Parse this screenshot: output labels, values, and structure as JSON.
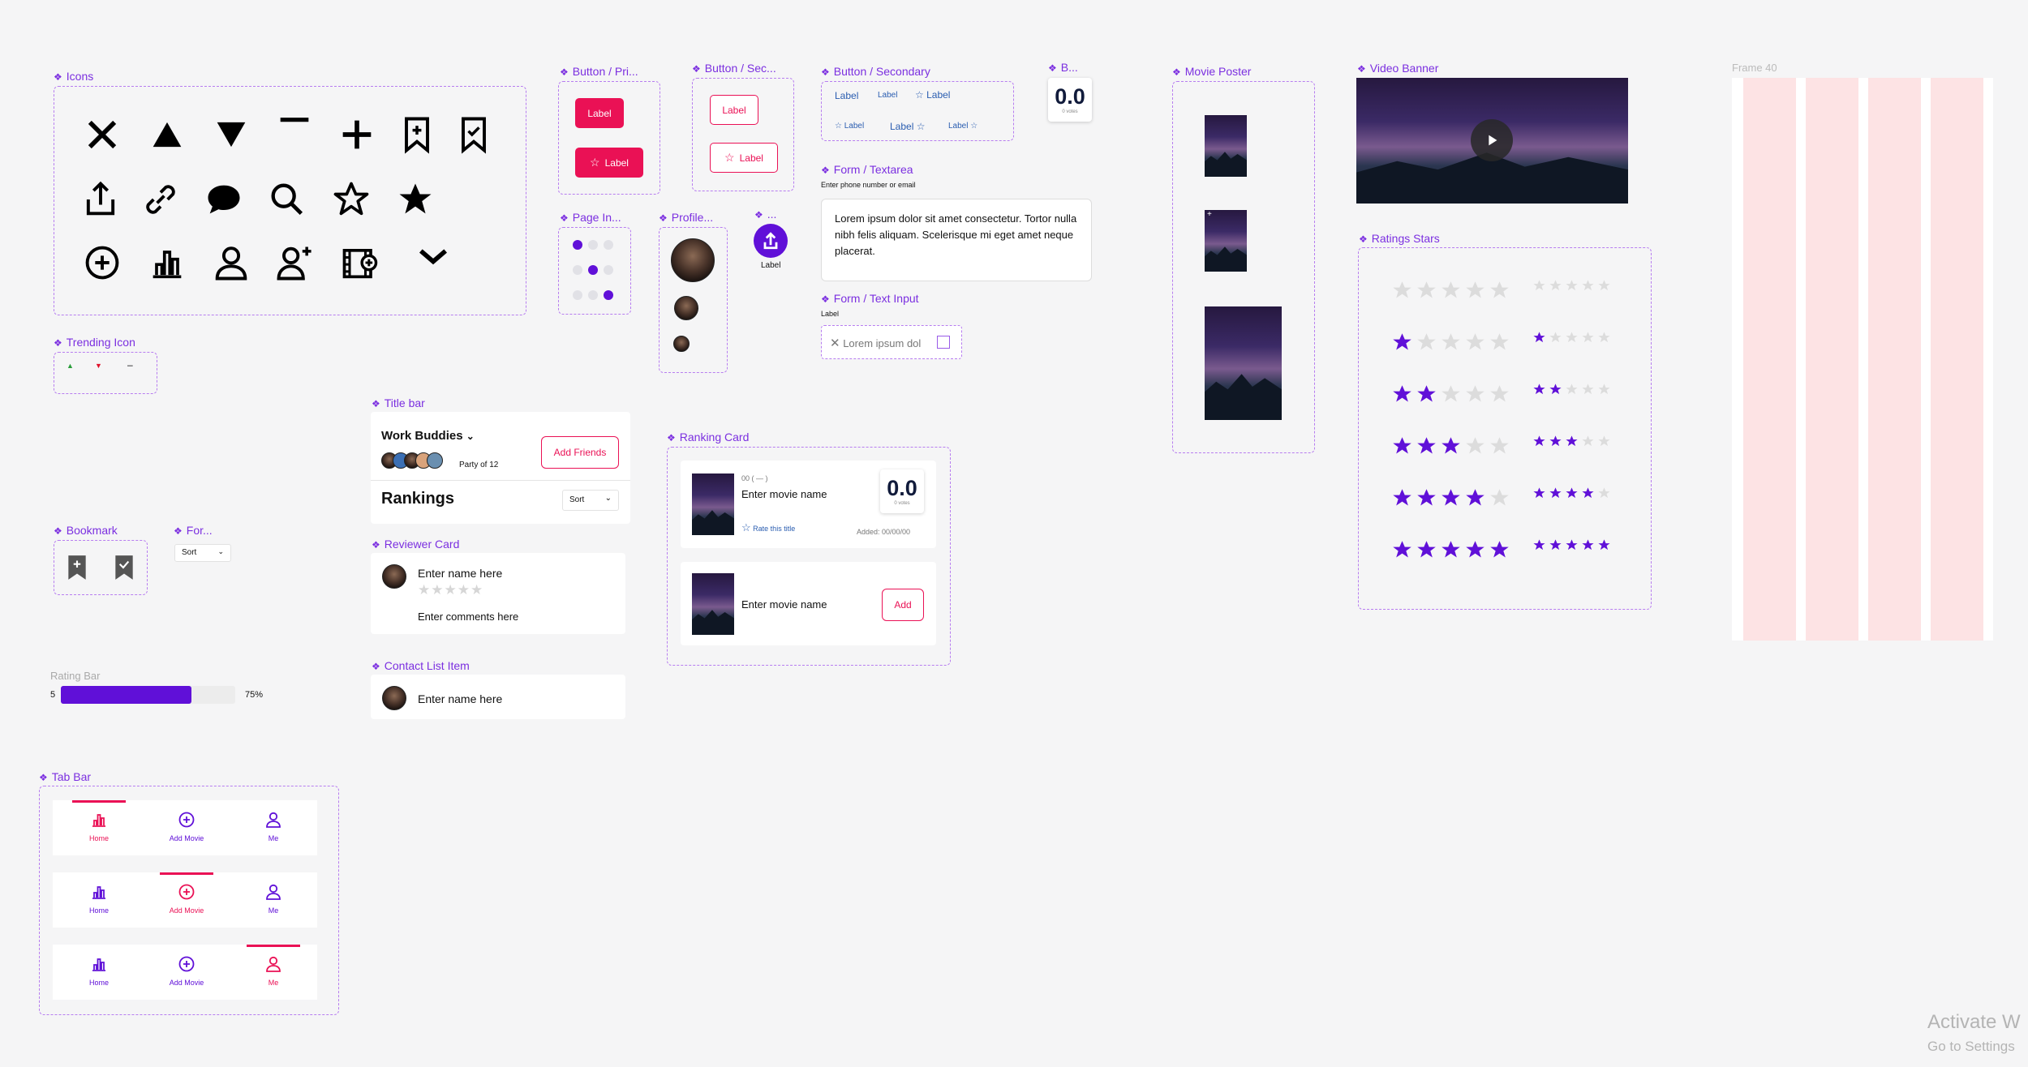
{
  "sections": {
    "icons": "Icons",
    "trending_icon": "Trending Icon",
    "bookmark": "Bookmark",
    "form_short": "For...",
    "rating_bar": "Rating Bar",
    "tab_bar": "Tab Bar",
    "button_primary": "Button / Pri...",
    "button_secondary_short": "Button / Sec...",
    "page_indicator": "Page In...",
    "profile": "Profile...",
    "fab": "...",
    "title_bar": "Title bar",
    "reviewer_card": "Reviewer Card",
    "contact_list_item": "Contact List Item",
    "button_secondary": "Button / Secondary",
    "badge": "B...",
    "form_textarea": "Form / Textarea",
    "form_text_input": "Form / Text Input",
    "ranking_card": "Ranking Card",
    "movie_poster": "Movie Poster",
    "video_banner": "Video Banner",
    "ratings_stars": "Ratings Stars",
    "frame40": "Frame 40"
  },
  "buttons": {
    "label": "Label"
  },
  "badge": {
    "value": "0.0",
    "sub": "0 votes"
  },
  "textarea": {
    "label": "Enter phone number or email",
    "value": "Lorem ipsum dolor sit amet consectetur. Tortor nulla nibh felis aliquam. Scelerisque mi eget amet neque placerat."
  },
  "text_input": {
    "label": "Label",
    "value": "Lorem ipsum dol"
  },
  "fab": {
    "label": "Label"
  },
  "title_bar": {
    "group": "Work Buddies",
    "party": "Party of 12",
    "add_friends": "Add Friends",
    "rankings": "Rankings",
    "sort": "Sort"
  },
  "sort_dropdown": "Sort",
  "reviewer": {
    "name": "Enter name here",
    "comments": "Enter comments here"
  },
  "contact": {
    "name": "Enter name here"
  },
  "ranking_card": {
    "rank": "00 ( — )",
    "movie": "Enter movie name",
    "rate": "Rate this title",
    "score": "0.0",
    "votes": "0 votes",
    "added": "Added: 00/00/00",
    "movie2": "Enter movie name",
    "add": "Add"
  },
  "rating_bar": {
    "left": "5",
    "right": "75%",
    "fill": 0.75
  },
  "tabs": {
    "home": "Home",
    "add": "Add Movie",
    "me": "Me"
  },
  "watermark": {
    "title": "Activate W",
    "sub": "Go to Settings"
  },
  "ratings": [
    0,
    1,
    2,
    3,
    4,
    5
  ],
  "colors": {
    "accent": "#ea1155",
    "purple": "#6010d8",
    "lilac": "#b77df0"
  }
}
